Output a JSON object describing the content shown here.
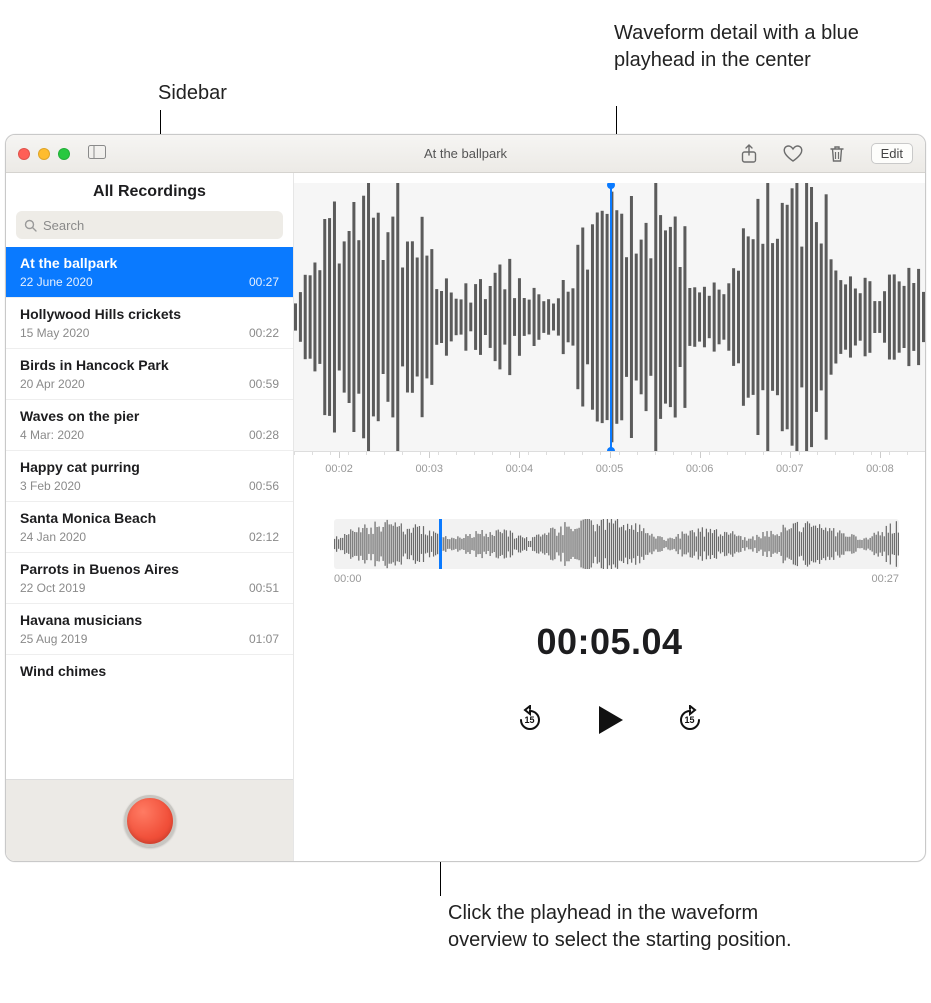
{
  "callouts": {
    "sidebar": "Sidebar",
    "waveform_detail": "Waveform detail with a blue playhead in the center",
    "overview_hint": "Click the playhead in the waveform overview to select the starting position."
  },
  "window": {
    "title": "At the ballpark",
    "edit_label": "Edit"
  },
  "sidebar": {
    "header": "All Recordings",
    "search_placeholder": "Search",
    "items": [
      {
        "title": "At the ballpark",
        "date": "22 June 2020",
        "duration": "00:27",
        "selected": true
      },
      {
        "title": "Hollywood Hills crickets",
        "date": "15 May 2020",
        "duration": "00:22"
      },
      {
        "title": "Birds in Hancock Park",
        "date": "20 Apr 2020",
        "duration": "00:59"
      },
      {
        "title": "Waves on the pier",
        "date": "4 Mar: 2020",
        "duration": "00:28"
      },
      {
        "title": "Happy cat purring",
        "date": "3 Feb 2020",
        "duration": "00:56"
      },
      {
        "title": "Santa Monica Beach",
        "date": "24 Jan 2020",
        "duration": "02:12"
      },
      {
        "title": "Parrots in Buenos Aires",
        "date": "22 Oct 2019",
        "duration": "00:51"
      },
      {
        "title": "Havana musicians",
        "date": "25 Aug 2019",
        "duration": "01:07"
      },
      {
        "title": "Wind chimes",
        "date": "",
        "duration": ""
      }
    ]
  },
  "detail": {
    "ruler_ticks": [
      "00:02",
      "00:03",
      "00:04",
      "00:05",
      "00:06",
      "00:07",
      "00:08"
    ],
    "overview_start": "00:00",
    "overview_end": "00:27",
    "timecode": "00:05.04",
    "skip_amount": "15"
  }
}
